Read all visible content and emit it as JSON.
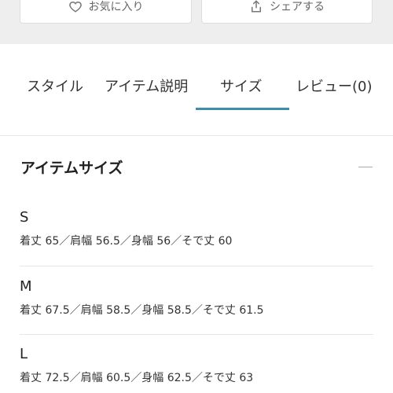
{
  "actions": {
    "favorite_label": "お気に入り",
    "share_label": "シェアする"
  },
  "tabs": [
    {
      "label": "スタイル"
    },
    {
      "label": "アイテム説明"
    },
    {
      "label": "サイズ",
      "active": true
    },
    {
      "label": "レビュー(0)"
    }
  ],
  "section": {
    "title": "アイテムサイズ",
    "collapse_icon": "minus-icon"
  },
  "sizes": [
    {
      "label": "S",
      "detail": "着丈 65／肩幅 56.5／身幅 56／そで丈 60"
    },
    {
      "label": "M",
      "detail": "着丈 67.5／肩幅 58.5／身幅 58.5／そで丈 61.5"
    },
    {
      "label": "L",
      "detail": "着丈 72.5／肩幅 60.5／身幅 62.5／そで丈 63"
    }
  ],
  "colors": {
    "accent": "#3d8ea9",
    "background_strip": "#eeeeee"
  }
}
